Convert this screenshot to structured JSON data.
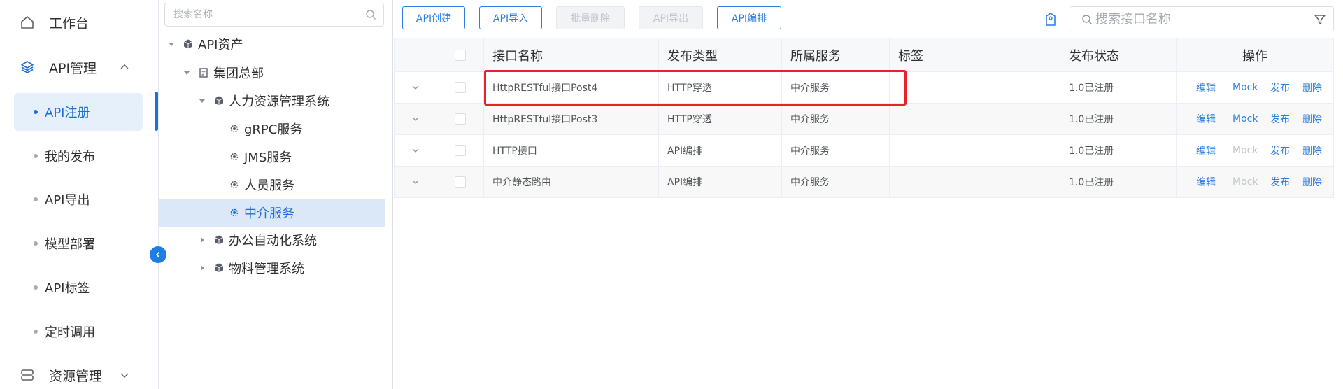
{
  "nav": {
    "workbench": {
      "label": "工作台",
      "icon": "home-icon"
    },
    "api_mgmt": {
      "label": "API管理",
      "icon": "layers-icon"
    },
    "sub_items": [
      {
        "label": "API注册",
        "active": true
      },
      {
        "label": "我的发布"
      },
      {
        "label": "API导出"
      },
      {
        "label": "模型部署"
      },
      {
        "label": "API标签"
      },
      {
        "label": "定时调用"
      }
    ],
    "resource_mgmt": {
      "label": "资源管理",
      "icon": "server-icon"
    }
  },
  "tree": {
    "search_placeholder": "搜索名称",
    "nodes": [
      {
        "label": "API资产",
        "icon": "cube-icon",
        "expanded": true
      },
      {
        "label": "集团总部",
        "icon": "document-icon",
        "expanded": true
      },
      {
        "label": "人力资源管理系统",
        "icon": "cube-icon",
        "expanded": true
      },
      {
        "label": "gRPC服务",
        "icon": "gear-icon"
      },
      {
        "label": "JMS服务",
        "icon": "gear-icon"
      },
      {
        "label": "人员服务",
        "icon": "gear-icon"
      },
      {
        "label": "中介服务",
        "icon": "gear-icon",
        "selected": true
      },
      {
        "label": "办公自动化系统",
        "icon": "cube-icon",
        "expanded": false
      },
      {
        "label": "物料管理系统",
        "icon": "cube-icon",
        "expanded": false
      }
    ]
  },
  "toolbar": {
    "create_label": "API创建",
    "import_label": "API导入",
    "batch_delete_label": "批量删除",
    "export_label": "API导出",
    "orchestrate_label": "API编排",
    "search_placeholder": "搜索接口名称"
  },
  "table": {
    "headers": {
      "name": "接口名称",
      "type": "发布类型",
      "service": "所属服务",
      "tag": "标签",
      "status": "发布状态",
      "ops": "操作"
    },
    "rows": [
      {
        "name": "HttpRESTful接口Post4",
        "type": "HTTP穿透",
        "service": "中介服务",
        "tag": "",
        "status": "1.0已注册",
        "ops": [
          "编辑",
          "Mock",
          "发布",
          "删除"
        ],
        "mock_enabled": true
      },
      {
        "name": "HttpRESTful接口Post3",
        "type": "HTTP穿透",
        "service": "中介服务",
        "tag": "",
        "status": "1.0已注册",
        "ops": [
          "编辑",
          "Mock",
          "发布",
          "删除"
        ],
        "mock_enabled": true
      },
      {
        "name": "HTTP接口",
        "type": "API编排",
        "service": "中介服务",
        "tag": "",
        "status": "1.0已注册",
        "ops": [
          "编辑",
          "Mock",
          "发布",
          "删除"
        ],
        "mock_enabled": false
      },
      {
        "name": "中介静态路由",
        "type": "API编排",
        "service": "中介服务",
        "tag": "",
        "status": "1.0已注册",
        "ops": [
          "编辑",
          "Mock",
          "发布",
          "删除"
        ],
        "mock_enabled": false
      }
    ]
  },
  "colors": {
    "accent": "#2f7fe0",
    "highlight": "#e8222a",
    "disabled": "#c0c4cc"
  }
}
